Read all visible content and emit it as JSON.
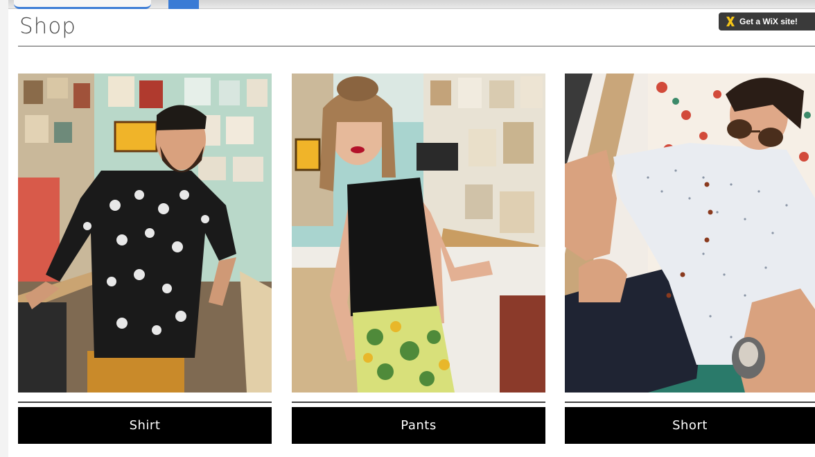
{
  "header": {
    "title": "Shop"
  },
  "wix_banner": {
    "label": "Get a WiX site!",
    "icon": "wix-x-icon",
    "logo_color": "#f5c518"
  },
  "products": [
    {
      "label": "Shirt",
      "photo": "man in black and white palm-print shirt in tattoo shop"
    },
    {
      "label": "Pants",
      "photo": "woman in black top and floral print pants in tattoo shop"
    },
    {
      "label": "Short",
      "photo": "man in sunglasses, dotted white shirt and navy shorts"
    }
  ],
  "colors": {
    "button_bg": "#000000",
    "button_text": "#ffffff",
    "title_text": "#4a4a4a",
    "accent_blue": "#3a7bd5"
  }
}
